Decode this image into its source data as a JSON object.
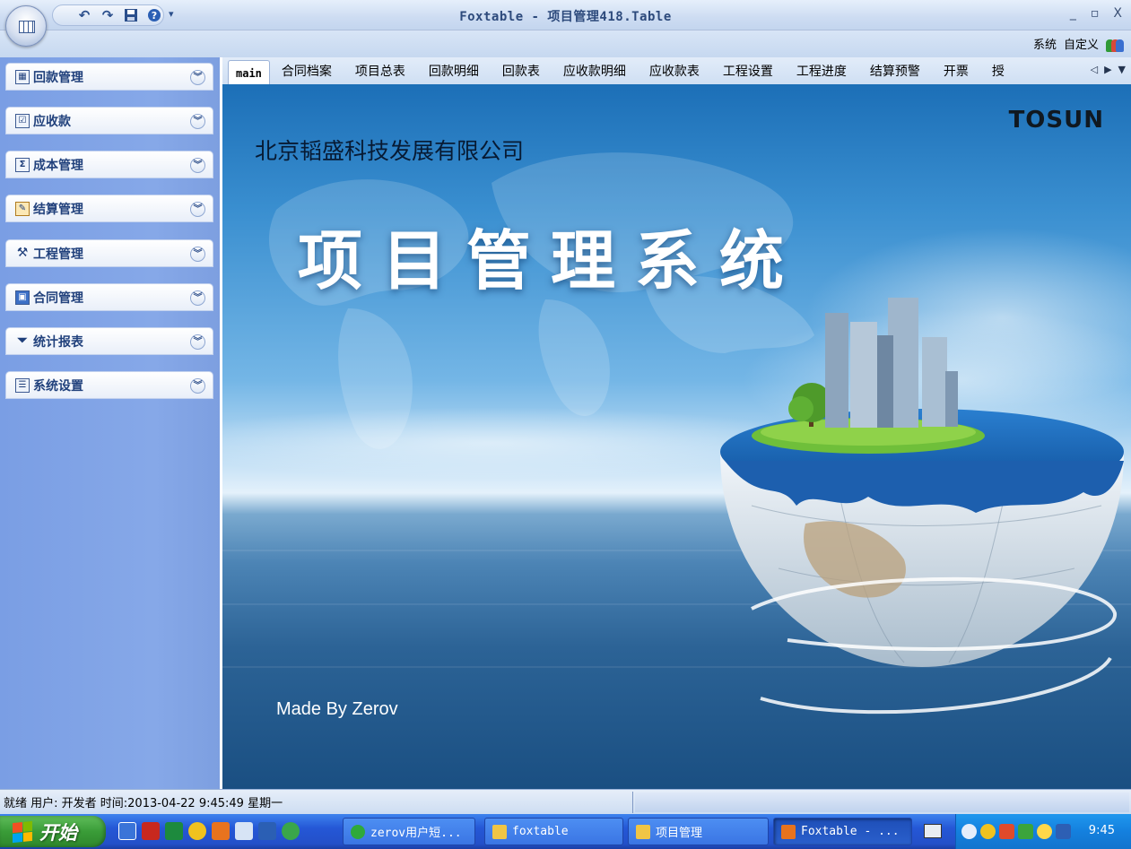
{
  "window": {
    "title": "Foxtable - 项目管理418.Table",
    "buttons": {
      "minimize": "_",
      "restore": "▫",
      "close": "X"
    }
  },
  "qat": {
    "more": "▾"
  },
  "menu": {
    "system": "系统",
    "customize": "自定义"
  },
  "sidebar": {
    "items": [
      {
        "label": "回款管理",
        "icon": "calculator-icon"
      },
      {
        "label": "应收款",
        "icon": "checklist-icon"
      },
      {
        "label": "成本管理",
        "icon": "sigma-icon"
      },
      {
        "label": "结算管理",
        "icon": "edit-note-icon"
      },
      {
        "label": "工程管理",
        "icon": "tools-icon"
      },
      {
        "label": "合同管理",
        "icon": "contract-icon"
      },
      {
        "label": "统计报表",
        "icon": "filter-icon"
      },
      {
        "label": "系统设置",
        "icon": "settings-panel-icon"
      }
    ]
  },
  "tabs": {
    "active": "main",
    "items": [
      "合同档案",
      "项目总表",
      "回款明细",
      "回款表",
      "应收款明细",
      "应收款表",
      "工程设置",
      "工程进度",
      "结算预警",
      "开票",
      "授"
    ]
  },
  "hero": {
    "company": "北京韬盛科技发展有限公司",
    "headline": "项目管理系统",
    "brand": "TOSUN",
    "credit": "Made By Zerov"
  },
  "statusbar": {
    "text": "就绪 用户: 开发者  时间:2013-04-22 9:45:49  星期一"
  },
  "taskbar": {
    "start": "开始",
    "tasks": [
      {
        "label": "zerov用户短...",
        "color": "#2fa93b"
      },
      {
        "label": "foxtable",
        "color": "#f0c545"
      },
      {
        "label": "项目管理",
        "color": "#f0c545"
      },
      {
        "label": "Foxtable - ...",
        "color": "#e8731e"
      }
    ],
    "clock": "9:45"
  },
  "colors": {
    "sidebar": "#7a9ee4",
    "taskbar": "#2350c9",
    "start": "#3a9c38",
    "navlabel": "#21417c"
  }
}
